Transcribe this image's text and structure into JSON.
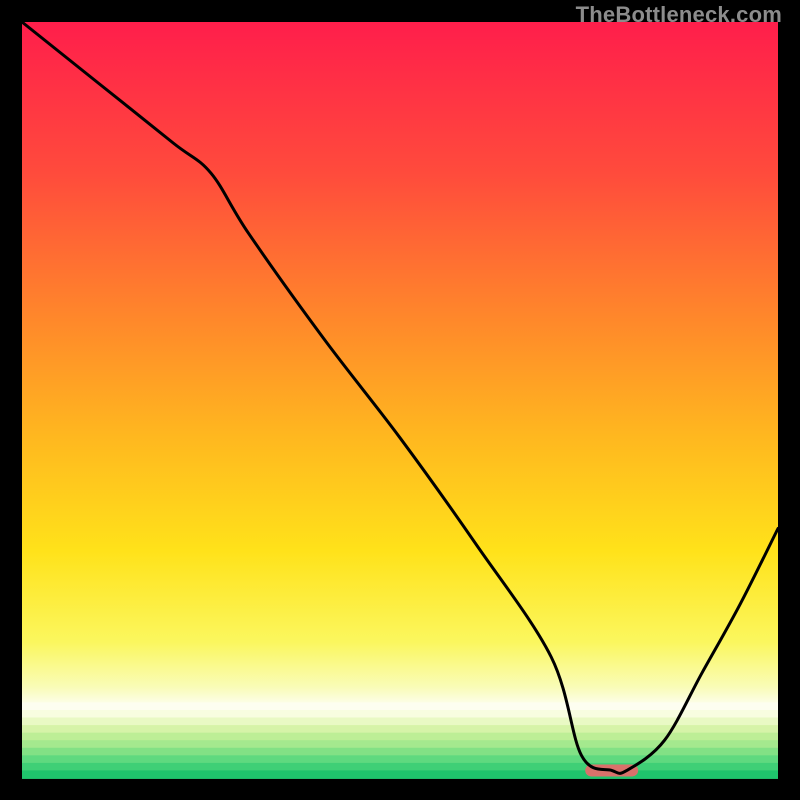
{
  "watermark": "TheBottleneck.com",
  "chart_data": {
    "type": "line",
    "title": "",
    "xlabel": "",
    "ylabel": "",
    "xlim": [
      0,
      100
    ],
    "ylim": [
      0,
      100
    ],
    "grid": false,
    "legend": false,
    "series": [
      {
        "name": "bottleneck-curve",
        "x": [
          0,
          10,
          20,
          25,
          30,
          40,
          50,
          60,
          70,
          74,
          78,
          80,
          85,
          90,
          95,
          100
        ],
        "y": [
          100,
          92,
          84,
          80,
          72,
          58,
          45,
          31,
          16,
          3,
          1,
          1,
          5,
          14,
          23,
          33
        ],
        "description": "V-shaped curve descending from top-left, with a slight knee near x≈25, reaching a flat minimum around x≈76–80, then rising toward the right edge."
      }
    ],
    "marker": {
      "name": "optimal-range-marker",
      "x_center": 78,
      "y": 1,
      "width_fraction": 0.07,
      "color": "#d9716b"
    },
    "background_gradient": {
      "type": "vertical-multi-with-bands",
      "stops": [
        {
          "offset": 0.0,
          "color": "#ff1e4b"
        },
        {
          "offset": 0.2,
          "color": "#ff4b3c"
        },
        {
          "offset": 0.4,
          "color": "#ff8a2a"
        },
        {
          "offset": 0.55,
          "color": "#ffb81f"
        },
        {
          "offset": 0.7,
          "color": "#ffe21a"
        },
        {
          "offset": 0.82,
          "color": "#fbf75e"
        },
        {
          "offset": 0.88,
          "color": "#f9fcb8"
        },
        {
          "offset": 0.905,
          "color": "#fdfef0"
        },
        {
          "offset": 0.915,
          "color": "#f8fde0"
        },
        {
          "offset": 0.93,
          "color": "#d6f3a8"
        },
        {
          "offset": 0.95,
          "color": "#a4e98e"
        },
        {
          "offset": 0.97,
          "color": "#5fd97f"
        },
        {
          "offset": 1.0,
          "color": "#1fc46c"
        }
      ],
      "bands_note": "Lower ~10% rendered as discrete horizontal bands from pale-yellow through green."
    },
    "line_style": {
      "color": "#000000",
      "width": 3
    },
    "frame_style": {
      "color": "#000000",
      "width": 22
    }
  }
}
